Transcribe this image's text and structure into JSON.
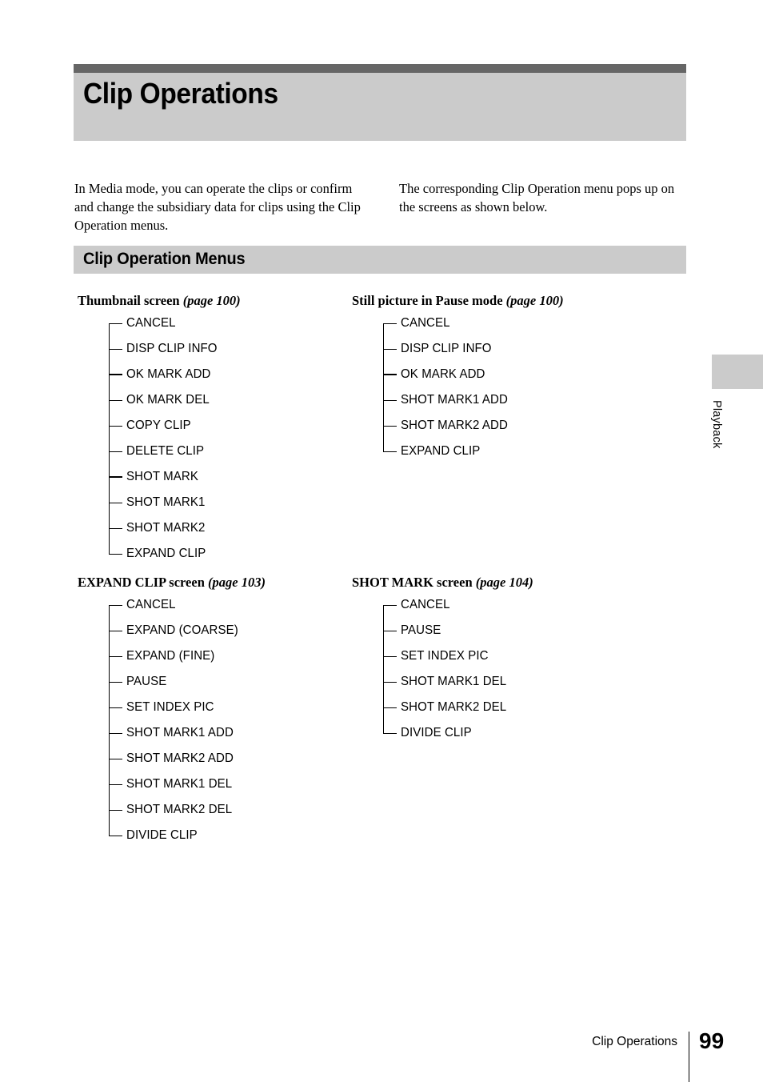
{
  "page": {
    "title": "Clip Operations",
    "chapter_tab": "Playback",
    "footer_chapter": "Clip Operations",
    "page_number": "99",
    "colors": {
      "banner_fill": "#cbcbcb",
      "banner_topbar": "#666666",
      "text": "#000000",
      "page_background": "#ffffff"
    }
  },
  "intro": {
    "left": "In Media mode, you can operate the clips or confirm and change the subsidiary data for clips using the Clip Operation menus.",
    "right": "The corresponding Clip Operation menu pops up on the screens as shown below."
  },
  "section": {
    "heading": "Clip Operation Menus"
  },
  "menus": [
    {
      "screen": "Thumbnail screen",
      "page_ref": "(page 100)",
      "items": [
        {
          "label": "CANCEL",
          "emphasis": false
        },
        {
          "label": "DISP CLIP INFO",
          "emphasis": false
        },
        {
          "label": "OK MARK ADD",
          "emphasis": true
        },
        {
          "label": "OK MARK DEL",
          "emphasis": false
        },
        {
          "label": "COPY CLIP",
          "emphasis": false
        },
        {
          "label": "DELETE CLIP",
          "emphasis": false
        },
        {
          "label": "SHOT MARK",
          "emphasis": true
        },
        {
          "label": "SHOT MARK1",
          "emphasis": false
        },
        {
          "label": "SHOT MARK2",
          "emphasis": false
        },
        {
          "label": "EXPAND CLIP",
          "emphasis": false
        }
      ]
    },
    {
      "screen": "Still picture in Pause mode",
      "page_ref": "(page 100)",
      "items": [
        {
          "label": "CANCEL",
          "emphasis": false
        },
        {
          "label": "DISP CLIP INFO",
          "emphasis": false
        },
        {
          "label": "OK MARK ADD",
          "emphasis": true
        },
        {
          "label": "SHOT MARK1 ADD",
          "emphasis": false
        },
        {
          "label": "SHOT MARK2 ADD",
          "emphasis": false
        },
        {
          "label": "EXPAND CLIP",
          "emphasis": false
        }
      ]
    },
    {
      "screen": "EXPAND CLIP screen",
      "page_ref": "(page 103)",
      "items": [
        {
          "label": "CANCEL",
          "emphasis": false
        },
        {
          "label": "EXPAND (COARSE)",
          "emphasis": false
        },
        {
          "label": "EXPAND (FINE)",
          "emphasis": false
        },
        {
          "label": "PAUSE",
          "emphasis": false
        },
        {
          "label": "SET INDEX PIC",
          "emphasis": false
        },
        {
          "label": "SHOT MARK1 ADD",
          "emphasis": false
        },
        {
          "label": "SHOT MARK2 ADD",
          "emphasis": false
        },
        {
          "label": "SHOT MARK1 DEL",
          "emphasis": false
        },
        {
          "label": "SHOT MARK2 DEL",
          "emphasis": false
        },
        {
          "label": "DIVIDE CLIP",
          "emphasis": false
        }
      ]
    },
    {
      "screen": "SHOT MARK screen",
      "page_ref": "(page 104)",
      "items": [
        {
          "label": "CANCEL",
          "emphasis": false
        },
        {
          "label": "PAUSE",
          "emphasis": false
        },
        {
          "label": "SET INDEX PIC",
          "emphasis": false
        },
        {
          "label": "SHOT MARK1 DEL",
          "emphasis": false
        },
        {
          "label": "SHOT MARK2 DEL",
          "emphasis": false
        },
        {
          "label": "DIVIDE CLIP",
          "emphasis": false
        }
      ]
    }
  ]
}
